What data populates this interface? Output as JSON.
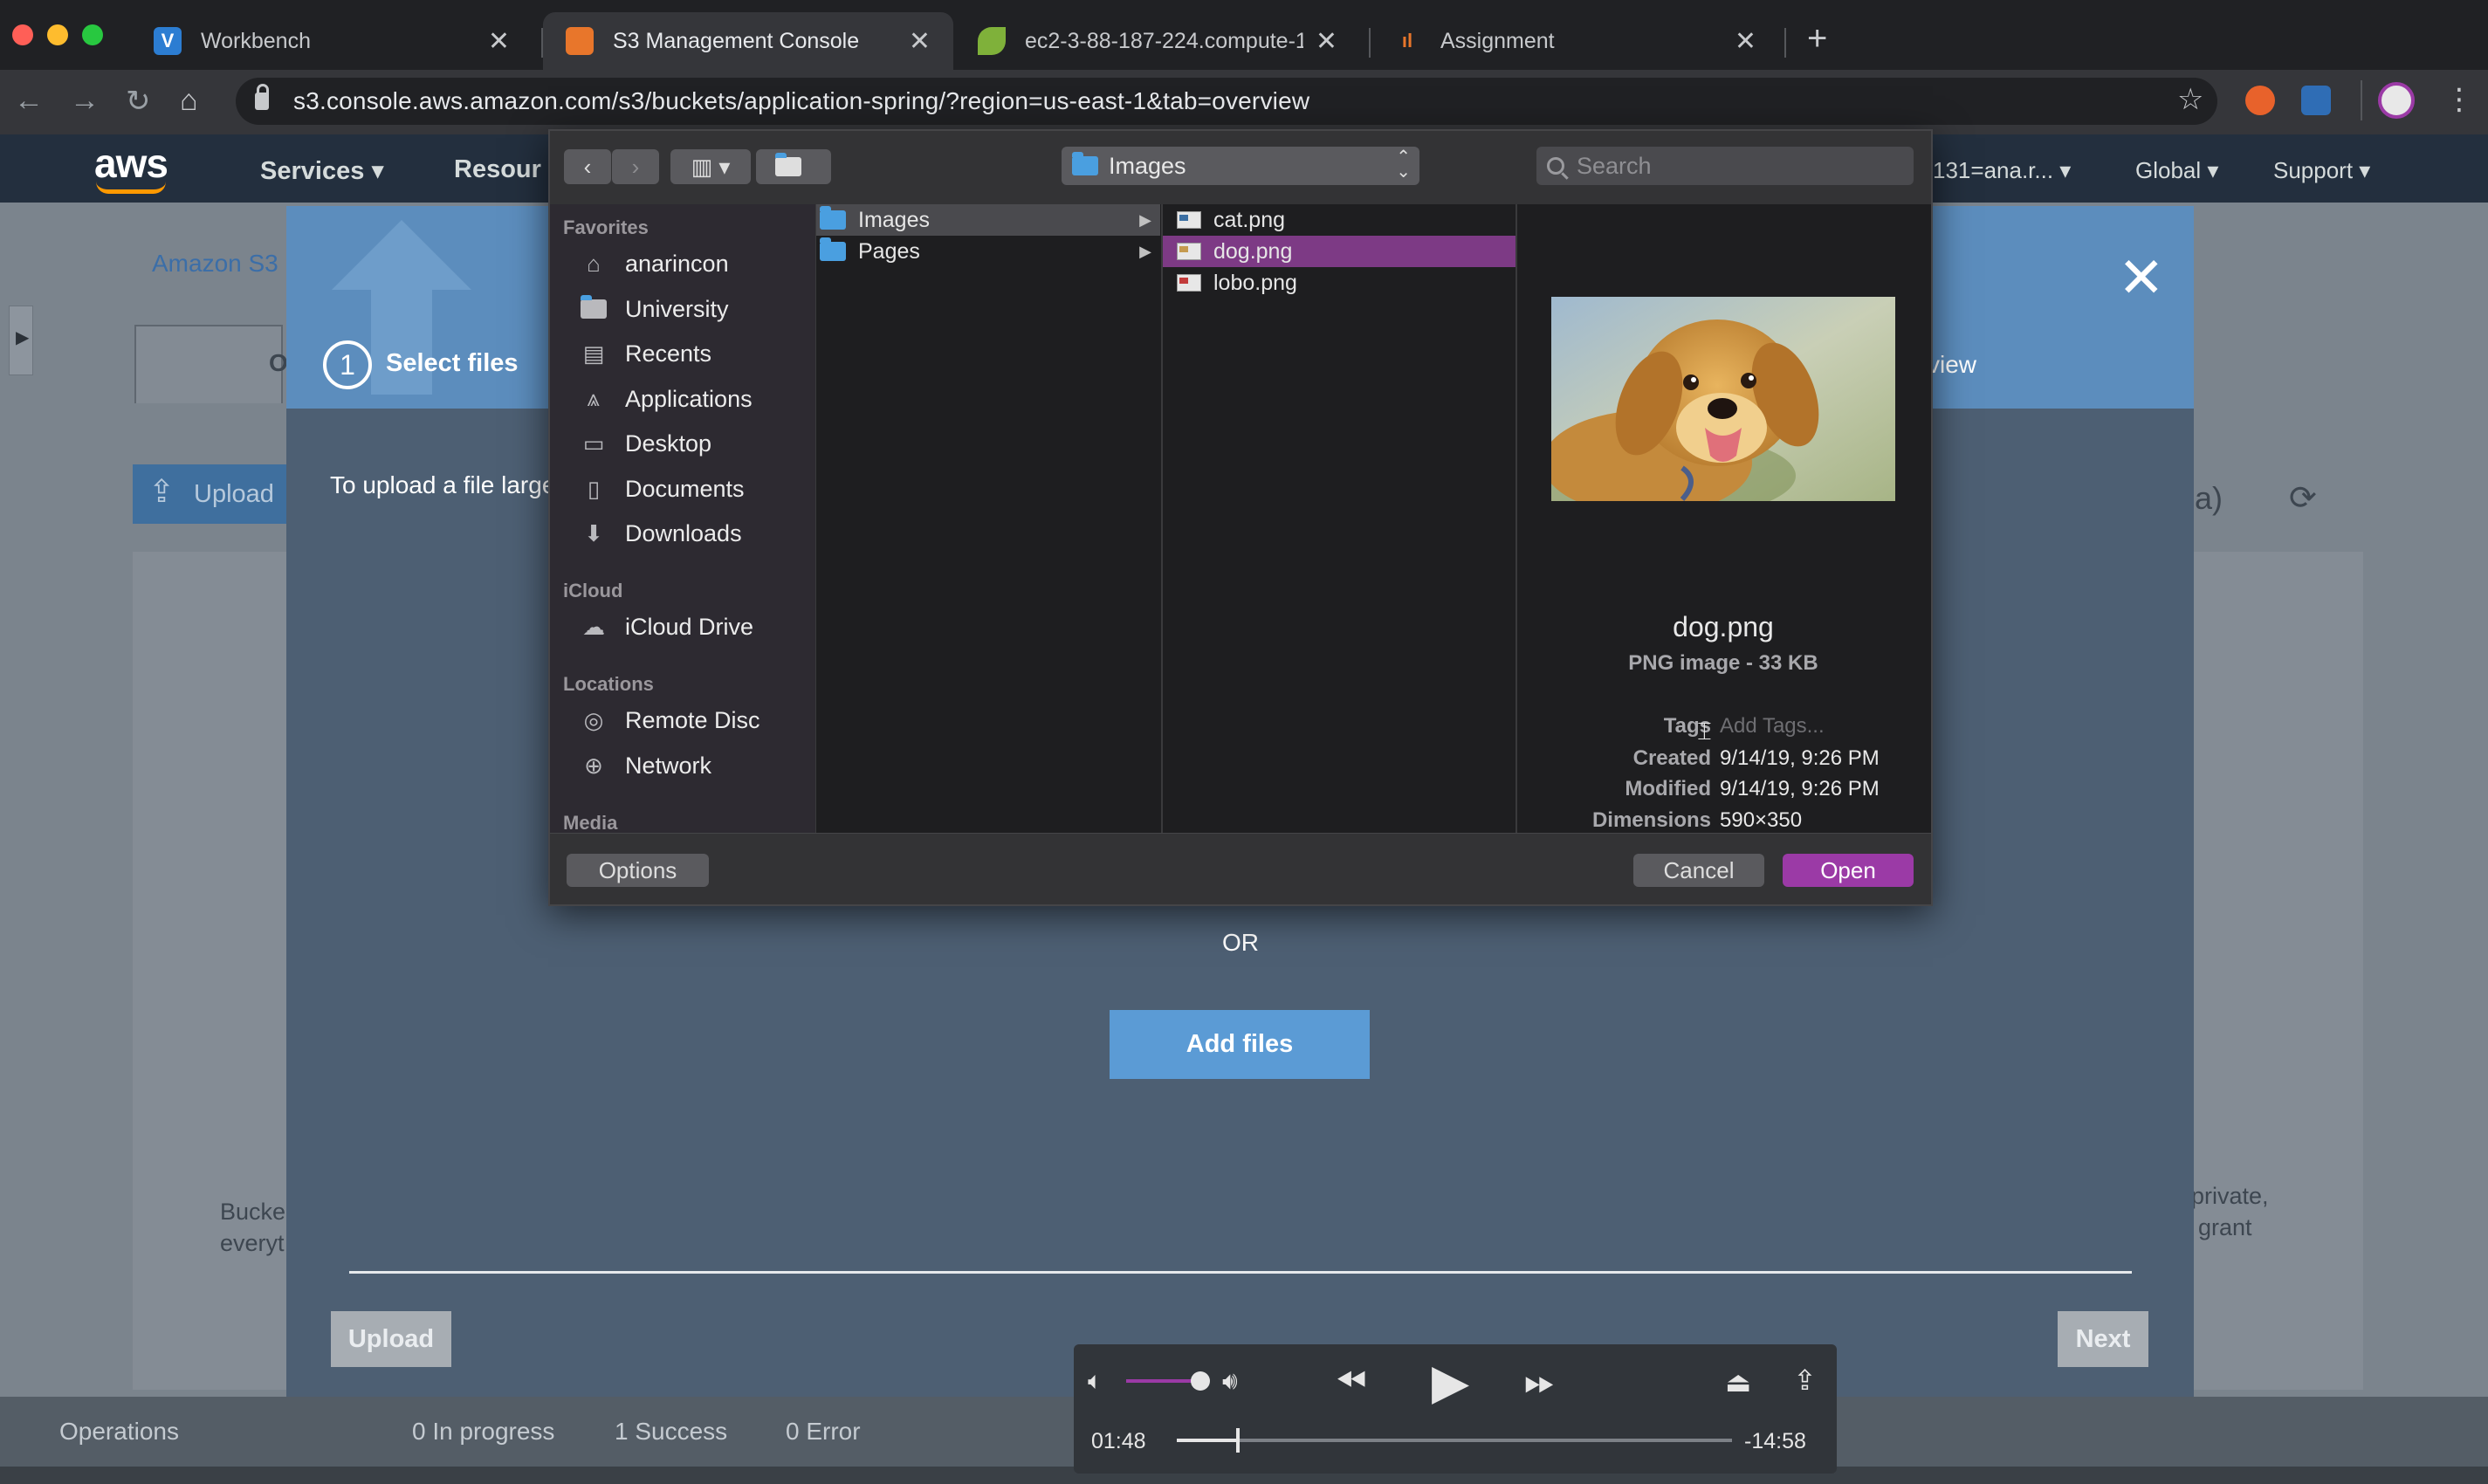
{
  "browser": {
    "tabs": [
      {
        "title": "Workbench",
        "favicon": "V",
        "active": false
      },
      {
        "title": "S3 Management Console",
        "favicon": "",
        "active": true
      },
      {
        "title": "ec2-3-88-187-224.compute-1",
        "favicon": "",
        "active": false
      },
      {
        "title": "Assignment",
        "favicon": "",
        "active": false
      }
    ],
    "close_glyph": "✕",
    "newtab_glyph": "+",
    "url": "s3.console.aws.amazon.com/s3/buckets/application-spring/?region=us-east-1&tab=overview"
  },
  "aws_nav": {
    "logo": "aws",
    "services": "Services ▾",
    "resources": "Resour",
    "account": "131=ana.r... ▾",
    "global": "Global ▾",
    "support": "Support ▾"
  },
  "page": {
    "breadcrumb": "Amazon S3",
    "tab_letter": "O",
    "upload_button": "Upload",
    "region": "inia)",
    "left_text_1": "Bucke",
    "left_text_2": "everyt",
    "right_text_1": "private,",
    "right_text_2": "grant"
  },
  "modal": {
    "step_number": "1",
    "step_label": "Select files",
    "step_review": "view",
    "info_text": "To upload a file large",
    "or_label": "OR",
    "add_files": "Add files",
    "upload_button": "Upload",
    "next_button": "Next"
  },
  "status_bar": {
    "operations": "Operations",
    "in_progress": "0 In progress",
    "success": "1 Success",
    "error": "0 Error"
  },
  "file_dialog": {
    "location": "Images",
    "search_placeholder": "Search",
    "sidebar": {
      "favorites_label": "Favorites",
      "favorites": [
        "anarincon",
        "University",
        "Recents",
        "Applications",
        "Desktop",
        "Documents",
        "Downloads"
      ],
      "icloud_label": "iCloud",
      "icloud": [
        "iCloud Drive"
      ],
      "locations_label": "Locations",
      "locations": [
        "Remote Disc",
        "Network"
      ],
      "media_label": "Media"
    },
    "column1": [
      "Images",
      "Pages"
    ],
    "column2": [
      "cat.png",
      "dog.png",
      "lobo.png"
    ],
    "selected_file": "dog.png",
    "preview": {
      "name": "dog.png",
      "kind": "PNG image - 33 KB",
      "tags_label": "Tags",
      "tags_placeholder": "Add Tags...",
      "created_label": "Created",
      "created": "9/14/19, 9:26 PM",
      "modified_label": "Modified",
      "modified": "9/14/19, 9:26 PM",
      "dimensions_label": "Dimensions",
      "dimensions": "590×350"
    },
    "options_button": "Options",
    "cancel_button": "Cancel",
    "open_button": "Open"
  },
  "player": {
    "current_time": "01:48",
    "remaining_time": "-14:58",
    "volume": 0.85,
    "progress": 0.11
  },
  "colors": {
    "accent_purple": "#9b3aa6",
    "aws_orange": "#ff9900",
    "add_files_blue": "#5b9bd5"
  }
}
